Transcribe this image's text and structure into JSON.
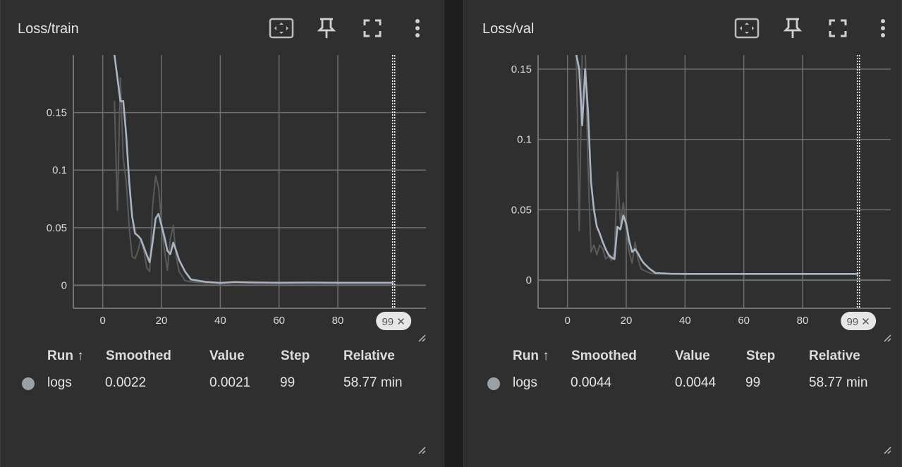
{
  "icons": {
    "fit": "fit-domain-icon",
    "pin": "pin-icon",
    "fullscreen": "fullscreen-icon",
    "more": "more-vert-icon",
    "resize": "resize-handle-icon"
  },
  "colors": {
    "background": "#2f2f2f",
    "smoothed_line": "#aab4c3",
    "raw_line": "#5a5a5a",
    "grid": "#6e6e6e",
    "run_dot": "#9aa0a6"
  },
  "table_headers": {
    "run": "Run ↑",
    "smoothed": "Smoothed",
    "value": "Value",
    "step": "Step",
    "relative": "Relative"
  },
  "cards": [
    {
      "title": "Loss/train",
      "step_badge": "99 ✕",
      "row": {
        "run": "logs",
        "smoothed": "0.0022",
        "value": "0.0021",
        "step": "99",
        "relative": "58.77 min"
      },
      "chart_data": {
        "type": "line",
        "x_ticks": [
          0,
          20,
          40,
          60,
          80
        ],
        "y_ticks": [
          0,
          0.05,
          0.1,
          0.15
        ],
        "y_tick_labels": [
          "0",
          "0.05",
          "0.1",
          "0.15"
        ],
        "xlim": [
          -10,
          110
        ],
        "ylim": [
          -0.02,
          0.2
        ],
        "cursor_step": 99,
        "series": [
          {
            "role": "raw",
            "x": [
              4,
              5,
              6,
              7,
              8,
              9,
              10,
              11,
              12,
              13,
              14,
              15,
              16,
              17,
              18,
              19,
              20,
              21,
              22,
              23,
              24,
              25,
              26,
              28,
              30,
              35,
              40,
              45,
              50,
              60,
              70,
              80,
              90,
              99
            ],
            "y": [
              0.16,
              0.065,
              0.18,
              0.11,
              0.09,
              0.05,
              0.025,
              0.023,
              0.03,
              0.04,
              0.03,
              0.015,
              0.012,
              0.07,
              0.095,
              0.085,
              0.055,
              0.03,
              0.013,
              0.04,
              0.052,
              0.025,
              0.012,
              0.004,
              0.003,
              0.002,
              0.002,
              0.0025,
              0.002,
              0.002,
              0.0022,
              0.002,
              0.0021,
              0.0021
            ]
          },
          {
            "role": "smoothed",
            "x": [
              4,
              5,
              6,
              7,
              8,
              9,
              10,
              11,
              12,
              13,
              14,
              15,
              16,
              17,
              18,
              19,
              20,
              21,
              22,
              23,
              24,
              25,
              26,
              28,
              30,
              35,
              40,
              45,
              50,
              60,
              70,
              80,
              90,
              99
            ],
            "y": [
              0.2,
              0.18,
              0.16,
              0.16,
              0.13,
              0.09,
              0.06,
              0.045,
              0.043,
              0.04,
              0.033,
              0.026,
              0.02,
              0.038,
              0.058,
              0.062,
              0.052,
              0.042,
              0.03,
              0.027,
              0.037,
              0.03,
              0.022,
              0.012,
              0.005,
              0.003,
              0.002,
              0.0028,
              0.0025,
              0.0022,
              0.0023,
              0.0022,
              0.0022,
              0.0022
            ]
          }
        ]
      }
    },
    {
      "title": "Loss/val",
      "step_badge": "99 ✕",
      "row": {
        "run": "logs",
        "smoothed": "0.0044",
        "value": "0.0044",
        "step": "99",
        "relative": "58.77 min"
      },
      "chart_data": {
        "type": "line",
        "x_ticks": [
          0,
          20,
          40,
          60,
          80
        ],
        "y_ticks": [
          0,
          0.05,
          0.1,
          0.15
        ],
        "y_tick_labels": [
          "0",
          "0.05",
          "0.1",
          "0.15"
        ],
        "xlim": [
          -10,
          110
        ],
        "ylim": [
          -0.02,
          0.16
        ],
        "cursor_step": 99,
        "series": [
          {
            "role": "raw",
            "x": [
              3,
              4,
              5,
              6,
              7,
              8,
              9,
              10,
              11,
              12,
              13,
              14,
              15,
              16,
              17,
              18,
              19,
              20,
              21,
              22,
              23,
              24,
              25,
              26,
              28,
              30,
              35,
              40,
              50,
              60,
              70,
              80,
              90,
              99
            ],
            "y": [
              0.16,
              0.035,
              0.16,
              0.17,
              0.08,
              0.02,
              0.025,
              0.018,
              0.025,
              0.022,
              0.015,
              0.017,
              0.014,
              0.02,
              0.077,
              0.04,
              0.055,
              0.035,
              0.02,
              0.012,
              0.027,
              0.015,
              0.008,
              0.007,
              0.005,
              0.0045,
              0.0045,
              0.0044,
              0.0044,
              0.0044,
              0.0044,
              0.0044,
              0.0044,
              0.0044
            ]
          },
          {
            "role": "smoothed",
            "x": [
              3,
              4,
              5,
              6,
              7,
              8,
              9,
              10,
              11,
              12,
              13,
              14,
              15,
              16,
              17,
              18,
              19,
              20,
              21,
              22,
              23,
              24,
              25,
              26,
              28,
              30,
              35,
              40,
              50,
              60,
              70,
              80,
              90,
              99
            ],
            "y": [
              0.16,
              0.15,
              0.11,
              0.15,
              0.12,
              0.07,
              0.05,
              0.038,
              0.033,
              0.027,
              0.022,
              0.018,
              0.016,
              0.015,
              0.038,
              0.036,
              0.046,
              0.04,
              0.028,
              0.02,
              0.022,
              0.019,
              0.015,
              0.012,
              0.008,
              0.005,
              0.0045,
              0.0044,
              0.0044,
              0.0044,
              0.0044,
              0.0044,
              0.0044,
              0.0044
            ]
          }
        ]
      }
    }
  ]
}
